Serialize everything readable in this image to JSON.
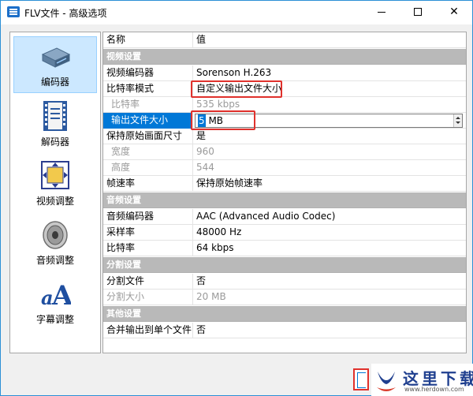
{
  "window": {
    "title": "FLV文件 - 高级选项"
  },
  "nav": {
    "items": [
      {
        "label": "编码器",
        "icon": "encoder-icon",
        "selected": true
      },
      {
        "label": "解码器",
        "icon": "decoder-icon",
        "selected": false
      },
      {
        "label": "视频调整",
        "icon": "video-adjust-icon",
        "selected": false
      },
      {
        "label": "音频调整",
        "icon": "speaker-icon",
        "selected": false
      },
      {
        "label": "字幕调整",
        "icon": "subtitle-icon",
        "selected": false
      }
    ]
  },
  "grid": {
    "header": {
      "name": "名称",
      "value": "值"
    },
    "video_category": "视频设置",
    "video_encoder": {
      "name": "视频编码器",
      "value": "Sorenson H.263"
    },
    "bitrate_mode": {
      "name": "比特率模式",
      "value": "自定义输出文件大小"
    },
    "bitrate": {
      "name": "比特率",
      "value": "535 kbps"
    },
    "output_size": {
      "name": "输出文件大小",
      "value_selected": "5",
      "value_rest": " MB"
    },
    "keep_size": {
      "name": "保持原始画面尺寸",
      "value": "是"
    },
    "width": {
      "name": "宽度",
      "value": "960"
    },
    "height": {
      "name": "高度",
      "value": "544"
    },
    "framerate": {
      "name": "帧速率",
      "value": "保持原始帧速率"
    },
    "audio_category": "音频设置",
    "audio_encoder": {
      "name": "音频编码器",
      "value": "AAC (Advanced Audio Codec)"
    },
    "sample_rate": {
      "name": "采样率",
      "value": "48000 Hz"
    },
    "audio_bitrate": {
      "name": "比特率",
      "value": "64 kbps"
    },
    "split_category": "分割设置",
    "split_file": {
      "name": "分割文件",
      "value": "否"
    },
    "split_size": {
      "name": "分割大小",
      "value": "20 MB"
    },
    "other_category": "其他设置",
    "merge_output": {
      "name": "合并输出到单个文件",
      "value": "否"
    }
  },
  "watermark": {
    "text": "这里下载",
    "url": "www.herdown.com"
  },
  "colors": {
    "accent": "#0078d7",
    "highlight": "#e0312c",
    "category_bg": "#b9b9b9"
  }
}
